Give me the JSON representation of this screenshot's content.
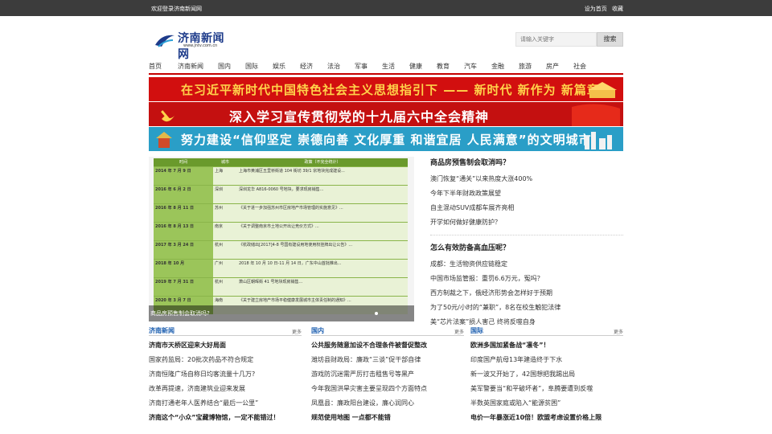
{
  "topbar": {
    "welcome": "欢迎登录济南新闻网",
    "set_home": "设为首页",
    "favorite": "收藏"
  },
  "logo": {
    "name": "济南新闻网",
    "url": "www.jntv.com.cn"
  },
  "search": {
    "placeholder": "请输入关键字",
    "button": "搜索"
  },
  "nav": [
    "首页",
    "济南新闻",
    "国内",
    "国际",
    "娱乐",
    "经济",
    "法治",
    "军事",
    "生活",
    "健康",
    "教育",
    "汽车",
    "金融",
    "旅游",
    "房产",
    "社会"
  ],
  "banners": [
    "在习近平新时代中国特色社会主义思想指引下 —— 新时代 新作为 新篇章",
    "深入学习宣传贯彻党的十九届六中全会精神",
    "努力建设“信仰坚定 崇德向善 文化厚重 和谐宜居 人民满意”的文明城市"
  ],
  "photo": {
    "caption": "商品房预售制会取消吗?",
    "table_headers": [
      "时间",
      "城市",
      "政策（不完全统计）"
    ],
    "rows": [
      {
        "date": "2014 年 7 月 9 日",
        "city": "上海",
        "policy": "上海市黄浦区五里桥街道 104 街坊 39/1 宗地块完成建设..."
      },
      {
        "date": "2016 年 6 月 2 日",
        "city": "深圳",
        "policy": "深圳龙华 A816-0060 号地块，要求现房销售..."
      },
      {
        "date": "2016 年 8 月 11 日",
        "city": "苏州",
        "policy": "《关于进一步加强苏州市区房地产市场管理的实施意见》..."
      },
      {
        "date": "2016 年 8 月 13 日",
        "city": "南京",
        "policy": "《关于调整南京市土地公开出让竞价方式》..."
      },
      {
        "date": "2017 年 3 月 24 日",
        "city": "杭州",
        "policy": "《杭政储出[2017]4-8 号国有建设用地使用权挂牌出让公告》..."
      },
      {
        "date": "2018 年 10 月",
        "city": "广州",
        "policy": "2018 年 10 月 10 日-11 月 14 日，广东中山首批推出..."
      },
      {
        "date": "2019 年 7 月 31 日",
        "city": "杭州",
        "policy": "萧山区朝晖街 41 号地块现房销售..."
      },
      {
        "date": "2020 年 3 月 7 日",
        "city": "海南",
        "policy": "《关于建立房地产市场平稳健康发展城市主体责任制的通知》..."
      }
    ]
  },
  "side": {
    "sections": [
      {
        "title": "商品房预售制会取消吗？",
        "items": [
          "澳门恢复“通关”以来热度大涨400%",
          "今年下半年财政政策展望",
          "自主混动SUV成都车展齐亮相",
          "开学如何做好健康防护？"
        ]
      },
      {
        "title": "怎么有效防备高血压呢？",
        "items": [
          "成都：生活物资供应链稳定",
          "中国市场监管报：重罚6.6万元，冤吗？",
          "西方制裁之下，俄经济形势会怎样好于预期",
          "为了50元/小时的“兼职”，8名在校生触犯法律",
          "美“芯片法案”损人害己 终将反噬自身"
        ]
      }
    ]
  },
  "columns": [
    {
      "title": "济南新闻",
      "more": "更多",
      "rows": [
        "济南市天桥区迎来大好局面",
        "国家药监局：20批次药品不符合规定",
        "济南恒隆广场自称日均客流量十几万?",
        "改革再提速，济南建筑业迎来发展",
        "济南打通老年人医养结合“最后一公里”",
        "济南这个“小众”宝藏博物馆，一定不能错过！"
      ]
    },
    {
      "title": "国内",
      "more": "更多",
      "rows": [
        "公共服务随意加设不合理条件被督促整改",
        "潍坊县财政局：廉政“三谈”促干部自律",
        "游戏防沉迷需严厉打击租售号等黑产",
        "今年我国洪旱灾害主要呈现四个方面特点",
        "凤凰县：廉政阳台建设，廉心润同心",
        "规范使用地图 一点都不能错"
      ]
    },
    {
      "title": "国际",
      "more": "更多",
      "rows": [
        "欧洲多国加紧备战“凛冬”！",
        "印度国产航母13年建造终于下水",
        "新一波又开始了，42国想把我踢出局",
        "美军警要当“和平破坏者”，阜腾要遭到反噬",
        "半数英国家庭或陷入“能源贫困”",
        "电价一年暴涨近10倍！欧盟考虑设置价格上限"
      ]
    }
  ],
  "colors": {
    "accent": "#c40000",
    "link_blue": "#1d5fb0",
    "topbar": "#3c3c3c"
  },
  "icons": {
    "logo_mark": "globe-swoosh-icon",
    "party_emblem": "hammer-sickle-icon"
  }
}
